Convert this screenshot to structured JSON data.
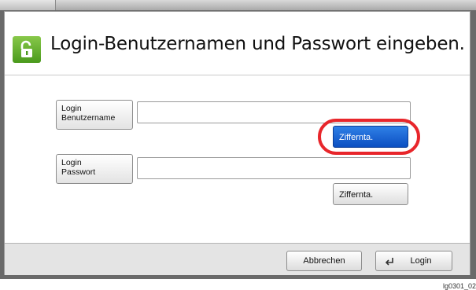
{
  "header": {
    "title": "Login-Benutzernamen und Passwort eingeben.",
    "icon": "unlocked-padlock-icon",
    "icon_color": "#5aa52a"
  },
  "form": {
    "username_label_line1": "Login",
    "username_label_line2": "Benutzername",
    "username_value": "",
    "username_keypad_label": "Ziffernta.",
    "password_label_line1": "Login",
    "password_label_line2": "Passwort",
    "password_value": "",
    "password_keypad_label": "Ziffernta."
  },
  "footer": {
    "cancel_label": "Abbrechen",
    "login_label": "Login",
    "login_icon": "enter-return-icon"
  },
  "caption": "lg0301_02",
  "colors": {
    "highlight": "#e8262b",
    "active_button": "#1a63d6"
  }
}
